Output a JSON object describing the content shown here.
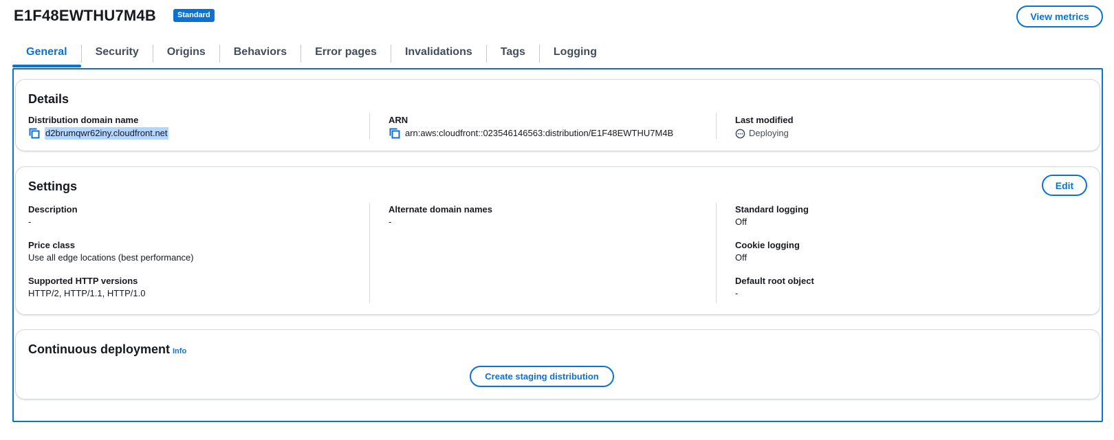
{
  "header": {
    "title": "E1F48EWTHU7M4B",
    "badge": "Standard",
    "view_metrics_label": "View metrics"
  },
  "tabs": [
    {
      "label": "General",
      "active": true
    },
    {
      "label": "Security",
      "active": false
    },
    {
      "label": "Origins",
      "active": false
    },
    {
      "label": "Behaviors",
      "active": false
    },
    {
      "label": "Error pages",
      "active": false
    },
    {
      "label": "Invalidations",
      "active": false
    },
    {
      "label": "Tags",
      "active": false
    },
    {
      "label": "Logging",
      "active": false
    }
  ],
  "details": {
    "title": "Details",
    "distribution_domain_name": {
      "label": "Distribution domain name",
      "value": "d2brumqwr62iny.cloudfront.net",
      "icon": "copy-icon"
    },
    "arn": {
      "label": "ARN",
      "value": "arn:aws:cloudfront::023546146563:distribution/E1F48EWTHU7M4B",
      "icon": "copy-icon"
    },
    "last_modified": {
      "label": "Last modified",
      "value": "Deploying",
      "icon": "pending-icon"
    }
  },
  "settings": {
    "title": "Settings",
    "edit_label": "Edit",
    "description": {
      "label": "Description",
      "value": "-"
    },
    "price_class": {
      "label": "Price class",
      "value": "Use all edge locations (best performance)"
    },
    "http_versions": {
      "label": "Supported HTTP versions",
      "value": "HTTP/2, HTTP/1.1, HTTP/1.0"
    },
    "alternate_domain_names": {
      "label": "Alternate domain names",
      "value": "-"
    },
    "standard_logging": {
      "label": "Standard logging",
      "value": "Off"
    },
    "cookie_logging": {
      "label": "Cookie logging",
      "value": "Off"
    },
    "default_root_object": {
      "label": "Default root object",
      "value": "-"
    }
  },
  "continuous_deployment": {
    "title": "Continuous deployment",
    "info_label": "Info",
    "create_staging_label": "Create staging distribution"
  },
  "colors": {
    "accent": "#0972d3",
    "text": "#16191f",
    "tab_text": "#414d5c",
    "selection": "#b4d5fe"
  }
}
